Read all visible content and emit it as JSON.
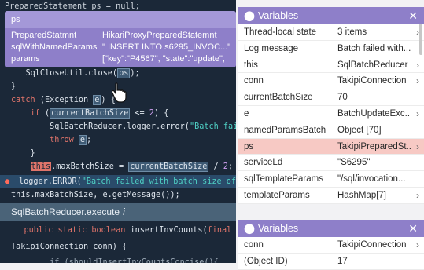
{
  "code": {
    "lines": [
      {
        "t": "PreparedStatement ps = null;"
      },
      {
        "t": ""
      },
      {
        "t": ""
      },
      {
        "t": ""
      },
      {
        "t": ""
      },
      {
        "t": "    SqlCloseUtil.close(",
        "hl": "ps",
        "tail": ");"
      },
      {
        "t": "}"
      },
      {
        "t": "catch (Exception ",
        "hl": "e",
        "tail": ") {"
      },
      {
        "t": "    if (",
        "hl": "currentBatchSize",
        "tail": " <= 2) {"
      },
      {
        "t": "        SqlBatchReducer.logger.error(",
        "str": "\"Batch failed w"
      },
      {
        "t": "        throw ",
        "hl": "e",
        "tail": ";"
      },
      {
        "t": "    }"
      },
      {
        "t": "    this.maxBatchSize = currentBatchSize / 2;"
      },
      {
        "t": "    logger.ERROR(\"Batch failed with batch size of {"
      },
      {
        "t": "this.maxBatchSize, e.getMessage());"
      }
    ],
    "exec_label": "SqlBatchReducer.execute",
    "exec_icon": "i",
    "lower": [
      "    public static boolean insertInvCounts(final Stri",
      "",
      "TakipiConnection conn) {",
      "",
      "        if (shouldInsertInvCountsConcise(){"
    ]
  },
  "tooltip": {
    "title": "ps",
    "rows": [
      {
        "k": "PreparedStatmnt",
        "v": "HikariProxyPreparedStatemnt"
      },
      {
        "k": "sqlWithNamedParams",
        "v": "\" INSERT INTO s6295_INVOC...\""
      },
      {
        "k": "params",
        "v": "[\"key\":\"P4567\", \"state\":\"update\","
      }
    ]
  },
  "variables": {
    "title": "Variables",
    "rows": [
      {
        "k": "Thread-local state",
        "v": "3 items",
        "chev": true
      },
      {
        "k": "Log message",
        "v": "Batch failed with...",
        "chev": false
      },
      {
        "k": "this",
        "v": "SqlBatchReducer",
        "chev": true
      },
      {
        "k": "conn",
        "v": "TakipiConnection",
        "chev": true
      },
      {
        "k": "currentBatchSize",
        "v": "70",
        "chev": false
      },
      {
        "k": "e",
        "v": "BatchUpdateExc...",
        "chev": true
      },
      {
        "k": "namedParamsBatch",
        "v": "Object [70]",
        "chev": false
      },
      {
        "k": "ps",
        "v": "TakipiPreparedSt...",
        "chev": true,
        "sel": true
      },
      {
        "k": "serviceLd",
        "v": "\"S6295\"",
        "chev": false
      },
      {
        "k": "sqlTemplateParams",
        "v": "\"/sql/invocation...",
        "chev": false
      },
      {
        "k": "templateParams",
        "v": "HashMap[7]",
        "chev": true
      }
    ]
  },
  "variables2": {
    "title": "Variables",
    "rows": [
      {
        "k": "conn",
        "v": "TakipiConnection",
        "chev": true
      },
      {
        "k": "(Object ID)",
        "v": "17",
        "chev": false
      }
    ]
  },
  "colors": {
    "code_bg": "#1b2838",
    "accent": "#8e7fc9",
    "selected_row": "#f7c9c4",
    "keyword": "#e0746a",
    "string": "#4fd1c5"
  }
}
